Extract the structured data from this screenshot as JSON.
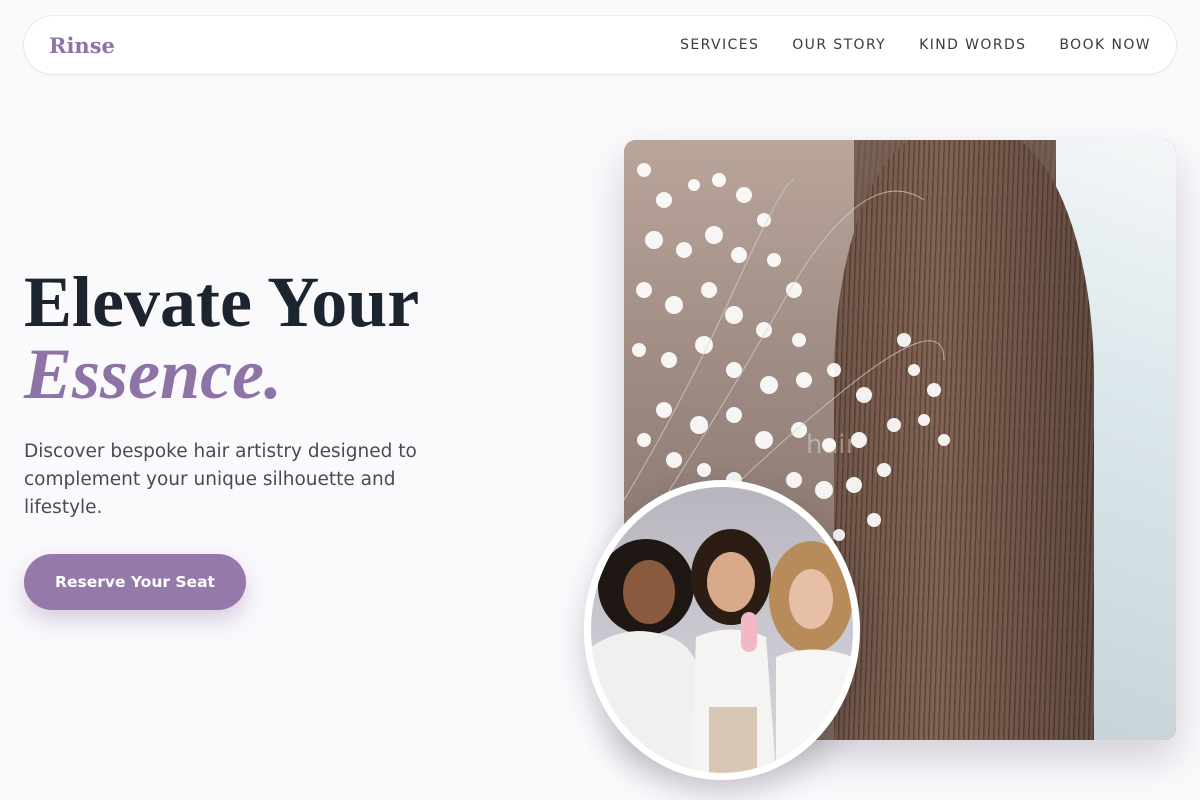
{
  "header": {
    "logo": "Rinse",
    "nav": [
      "SERVICES",
      "OUR STORY",
      "KIND WORDS",
      "BOOK NOW"
    ]
  },
  "hero": {
    "title_line1": "Elevate Your",
    "title_line2": "Essence.",
    "description": "Discover bespoke hair artistry designed to complement your unique silhouette and lifestyle.",
    "cta": "Reserve Your Seat"
  },
  "images": {
    "main_photo": "long-straight-brown-hair-with-baby-breath-flowers",
    "circle_photo": "three-women-with-styled-hair-and-hair-tool",
    "watermark": "hair"
  },
  "colors": {
    "accent": "#8e73a6",
    "button": "#9479aa",
    "heading": "#1c2430",
    "text": "#4a4a55",
    "background": "#faf9fc"
  }
}
